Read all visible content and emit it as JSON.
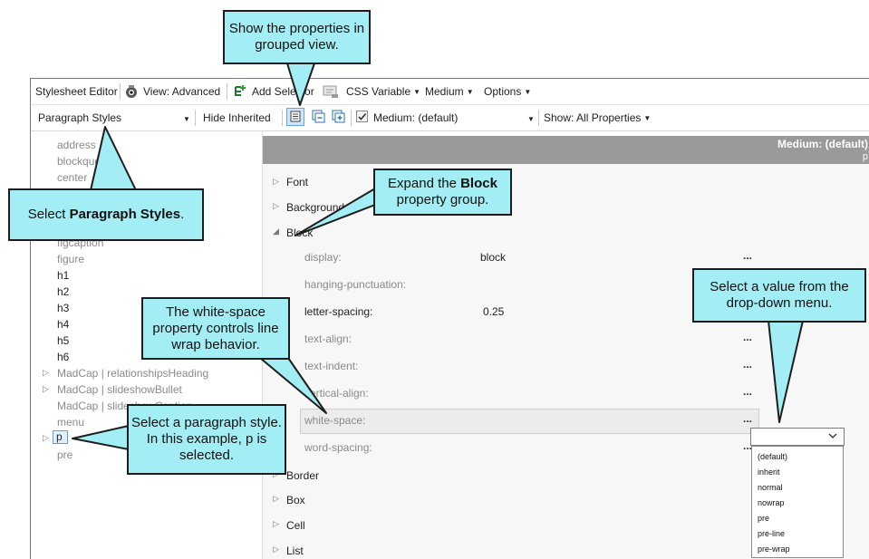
{
  "toolbar1": {
    "title": "Stylesheet Editor",
    "view": "View: Advanced",
    "add_selector": "Add Selector",
    "css_variable": "CSS Variable",
    "medium": "Medium",
    "options": "Options"
  },
  "toolbar2": {
    "style_select": "Paragraph Styles",
    "hide_inherited": "Hide Inherited",
    "medium_select": "Medium: (default)",
    "show": "Show: All Properties"
  },
  "styles_list": [
    {
      "label": "address"
    },
    {
      "label": "blockquote"
    },
    {
      "label": "center"
    },
    {
      "label": "figcaption"
    },
    {
      "label": "figure"
    },
    {
      "label": "h1"
    },
    {
      "label": "h2"
    },
    {
      "label": "h3"
    },
    {
      "label": "h4"
    },
    {
      "label": "h5"
    },
    {
      "label": "h6"
    },
    {
      "label": "MadCap | relationshipsHeading"
    },
    {
      "label": "MadCap | slideshowBullet"
    },
    {
      "label": "MadCap | slideshowCaption"
    },
    {
      "label": "menu"
    },
    {
      "label": "p"
    },
    {
      "label": "pre"
    }
  ],
  "right_header": {
    "line1": "Medium: (default)",
    "line2": "p"
  },
  "groups": [
    {
      "label": "Font"
    },
    {
      "label": "Background"
    },
    {
      "label": "Block"
    },
    {
      "label": "Border"
    },
    {
      "label": "Box"
    },
    {
      "label": "Cell"
    },
    {
      "label": "List"
    }
  ],
  "properties": [
    {
      "name": "display:",
      "value": "block",
      "dots": "..."
    },
    {
      "name": "hanging-punctuation:",
      "value": "",
      "dots": ""
    },
    {
      "name": "letter-spacing:",
      "value": "0.25",
      "dots": ""
    },
    {
      "name": "text-align:",
      "value": "",
      "dots": "..."
    },
    {
      "name": "text-indent:",
      "value": "",
      "dots": "..."
    },
    {
      "name": "vertical-align:",
      "value": "",
      "dots": "..."
    },
    {
      "name": "white-space:",
      "value": "",
      "dots": "..."
    },
    {
      "name": "word-spacing:",
      "value": "",
      "dots": "..."
    }
  ],
  "dropdown": {
    "options": [
      "(default)",
      "inherit",
      "normal",
      "nowrap",
      "pre",
      "pre-line",
      "pre-wrap"
    ]
  },
  "callouts": {
    "grouped_view": "Show the properties in grouped view.",
    "select_styles_pre": "Select ",
    "select_styles_bold": "Paragraph Styles",
    "select_styles_post": ".",
    "expand_pre": "Expand the ",
    "expand_bold": "Block",
    "expand_post": "property group.",
    "dropdown_value": "Select a value from the drop-down menu.",
    "white_space": "The white-space property controls line wrap behavior.",
    "paragraph": "Select a paragraph style. In this example, p is selected."
  },
  "colors": {
    "callout_fill": "#a3eef4",
    "callout_stroke": "#1d1d1d",
    "header_gray": "#9a9a9a"
  }
}
